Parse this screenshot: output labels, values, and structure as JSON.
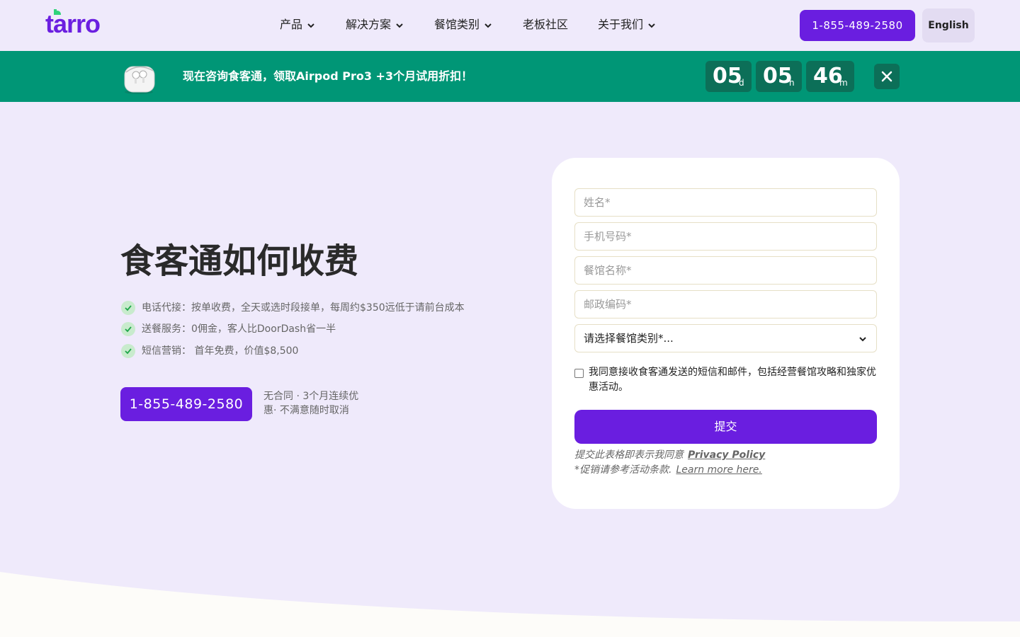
{
  "header": {
    "logo_text": "tarro",
    "nav": [
      {
        "label": "产品",
        "dropdown": true
      },
      {
        "label": "解决方案",
        "dropdown": true
      },
      {
        "label": "餐馆类别",
        "dropdown": true
      },
      {
        "label": "老板社区",
        "dropdown": false
      },
      {
        "label": "关于我们",
        "dropdown": true
      }
    ],
    "phone": "1-855-489-2580",
    "language": "English"
  },
  "promo": {
    "text": "现在咨询食客通，领取Airpod Pro3 +3个月试用折扣！",
    "countdown": [
      {
        "value": "05",
        "unit": "d"
      },
      {
        "value": "05",
        "unit": "h"
      },
      {
        "value": "46",
        "unit": "m"
      }
    ]
  },
  "hero": {
    "title": "食客通如何收费",
    "features": [
      "电话代接：按单收费，全天或选时段接单，每周约$350远低于请前台成本",
      "送餐服务：0佣金，客人比DoorDash省一半",
      "短信营销： 首年免费，价值$8,500"
    ],
    "phone": "1-855-489-2580",
    "note": "无合同 · 3个月连续优惠· 不满意随时取消"
  },
  "form": {
    "name_placeholder": "姓名*",
    "phone_placeholder": "手机号码*",
    "restaurant_placeholder": "餐馆名称*",
    "zip_placeholder": "邮政编码*",
    "category_select": "请选择餐馆类别*...",
    "consent": "我同意接收食客通发送的短信和邮件，包括经营餐馆攻略和独家优惠活动。",
    "submit": "提交",
    "privacy_prefix": "提交此表格即表示我同意",
    "privacy_link": "Privacy Policy",
    "terms_prefix": "*促销请参考活动条款.",
    "terms_link": "Learn more here."
  },
  "colors": {
    "brand": "#6a1ee0",
    "promo_bg": "#009676",
    "page_bg": "#efeafb",
    "check": "#1fa64a"
  }
}
